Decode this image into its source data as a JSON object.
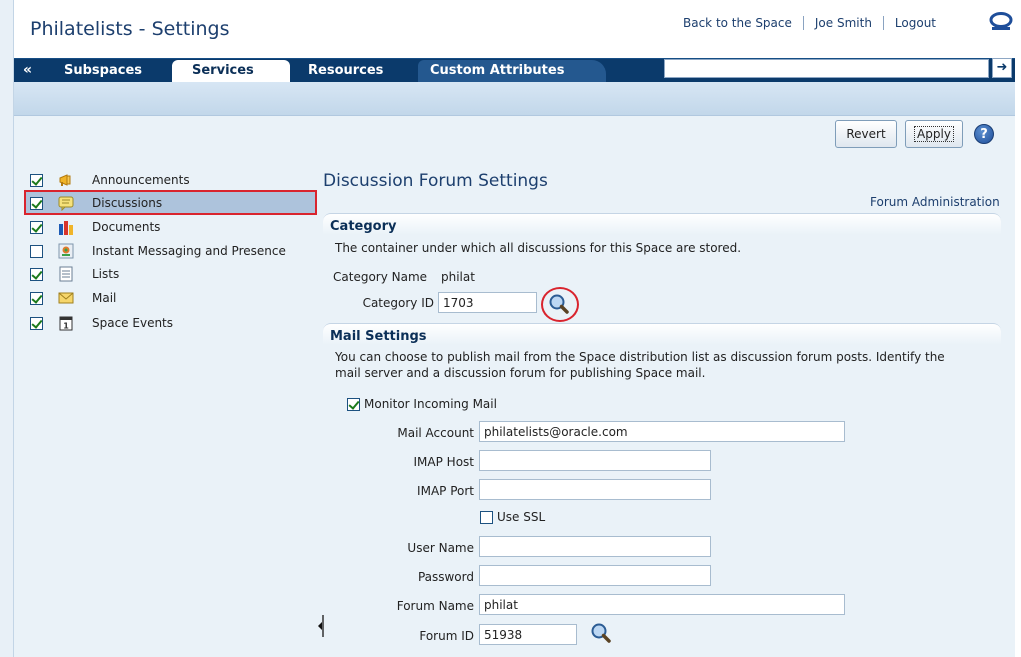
{
  "header": {
    "title": "Philatelists - Settings",
    "links": [
      "Back to the Space",
      "Joe Smith",
      "Logout"
    ],
    "logo_icon": "oracle-logo-icon"
  },
  "tabs": {
    "collapse_label": "«",
    "items": [
      {
        "label": "Subspaces",
        "active": false
      },
      {
        "label": "Services",
        "active": true
      },
      {
        "label": "Resources",
        "active": false
      },
      {
        "label": "Custom Attributes",
        "active": false
      }
    ],
    "search_value": "",
    "go_label": "➜"
  },
  "toolbar": {
    "revert_label": "Revert",
    "apply_label": "Apply",
    "help_label": "?"
  },
  "services": [
    {
      "label": "Announcements",
      "checked": true,
      "icon": "megaphone-icon",
      "selected": false
    },
    {
      "label": "Discussions",
      "checked": true,
      "icon": "speech-bubble-icon",
      "selected": true
    },
    {
      "label": "Documents",
      "checked": true,
      "icon": "documents-icon",
      "selected": false
    },
    {
      "label": "Instant Messaging and Presence",
      "checked": false,
      "icon": "presence-icon",
      "selected": false
    },
    {
      "label": "Lists",
      "checked": true,
      "icon": "list-icon",
      "selected": false
    },
    {
      "label": "Mail",
      "checked": true,
      "icon": "envelope-icon",
      "selected": false
    },
    {
      "label": "Space Events",
      "checked": true,
      "icon": "calendar-icon",
      "selected": false
    }
  ],
  "panel": {
    "title": "Discussion Forum Settings",
    "forum_admin_link": "Forum Administration",
    "category": {
      "title": "Category",
      "description": "The container under which all discussions for this Space are stored.",
      "name_label": "Category Name",
      "name_value": "philat",
      "id_label": "Category ID",
      "id_value": "1703"
    },
    "mail": {
      "title": "Mail Settings",
      "description_line1": "You can choose to publish mail from the Space distribution list as discussion forum posts. Identify the",
      "description_line2": "mail server and a discussion forum for publishing Space mail.",
      "monitor_label": "Monitor Incoming Mail",
      "monitor_checked": true,
      "account_label": "Mail Account",
      "account_value": "philatelists@oracle.com",
      "imap_host_label": "IMAP Host",
      "imap_host_value": "",
      "imap_port_label": "IMAP Port",
      "imap_port_value": "",
      "ssl_label": "Use SSL",
      "ssl_checked": false,
      "user_label": "User Name",
      "user_value": "",
      "password_label": "Password",
      "password_value": "",
      "forum_name_label": "Forum Name",
      "forum_name_value": "philat",
      "forum_id_label": "Forum ID",
      "forum_id_value": "51938"
    }
  },
  "colors": {
    "tabbar": "#0b3a6b",
    "highlight": "#d9242e",
    "selected_row": "#adc3dc",
    "heading": "#1d3f6e"
  }
}
